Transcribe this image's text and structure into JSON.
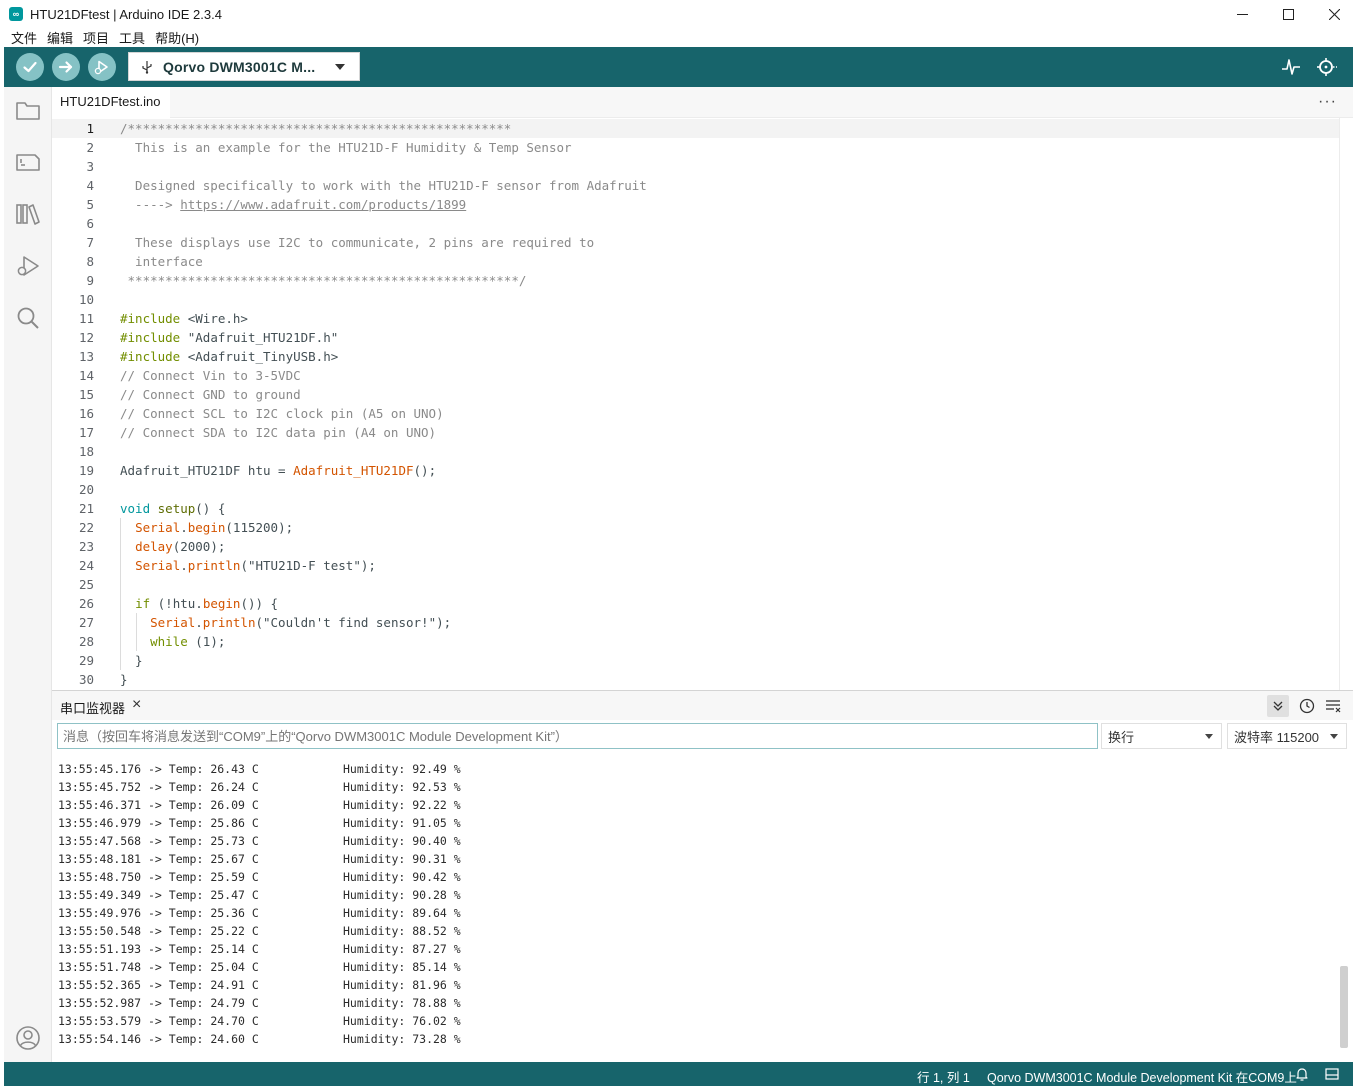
{
  "window": {
    "title": "HTU21DFtest | Arduino IDE 2.3.4",
    "icon": "arduino-logo-icon"
  },
  "menu": [
    "文件",
    "编辑",
    "项目",
    "工具",
    "帮助(H)"
  ],
  "toolbar": {
    "board": "Qorvo DWM3001C M...",
    "verify_icon": "checkmark-icon",
    "upload_icon": "arrow-right-icon",
    "debug_icon": "debug-icon",
    "plotter_icon": "serial-plotter-icon",
    "monitor_icon": "serial-monitor-icon"
  },
  "sidebar": [
    "folder-icon",
    "board-manager-icon",
    "library-icon",
    "debug-icon",
    "search-icon",
    "account-icon"
  ],
  "editor": {
    "tab": "HTU21DFtest.ino",
    "more": "···",
    "current_line": 1,
    "lines": [
      [
        {
          "t": "/***************************************************",
          "c": "#8a8a8a"
        }
      ],
      [
        {
          "t": "  This is an example for the HTU21D-F Humidity & Temp Sensor",
          "c": "#8a8a8a"
        }
      ],
      [
        {
          "t": "",
          "c": "#8a8a8a"
        }
      ],
      [
        {
          "t": "  Designed specifically to work with the HTU21D-F sensor from Adafruit",
          "c": "#8a8a8a"
        }
      ],
      [
        {
          "t": "  ----> ",
          "c": "#8a8a8a"
        },
        {
          "t": "https://www.adafruit.com/products/1899",
          "c": "#8a8a8a",
          "u": true
        }
      ],
      [
        {
          "t": "",
          "c": "#8a8a8a"
        }
      ],
      [
        {
          "t": "  These displays use I2C to communicate, 2 pins are required to",
          "c": "#8a8a8a"
        }
      ],
      [
        {
          "t": "  interface",
          "c": "#8a8a8a"
        }
      ],
      [
        {
          "t": " ****************************************************/",
          "c": "#8a8a8a"
        }
      ],
      [
        {
          "t": "",
          "c": "#434f54"
        }
      ],
      [
        {
          "t": "#include",
          "c": "#728e00"
        },
        {
          "t": " <Wire.h>",
          "c": "#434f54"
        }
      ],
      [
        {
          "t": "#include",
          "c": "#728e00"
        },
        {
          "t": " \"Adafruit_HTU21DF.h\"",
          "c": "#434f54"
        }
      ],
      [
        {
          "t": "#include",
          "c": "#728e00"
        },
        {
          "t": " <Adafruit_TinyUSB.h>",
          "c": "#434f54"
        }
      ],
      [
        {
          "t": "// Connect Vin to 3-5VDC",
          "c": "#8a8a8a"
        }
      ],
      [
        {
          "t": "// Connect GND to ground",
          "c": "#8a8a8a"
        }
      ],
      [
        {
          "t": "// Connect SCL to I2C clock pin (A5 on UNO)",
          "c": "#8a8a8a"
        }
      ],
      [
        {
          "t": "// Connect SDA to I2C data pin (A4 on UNO)",
          "c": "#8a8a8a"
        }
      ],
      [
        {
          "t": "",
          "c": "#434f54"
        }
      ],
      [
        {
          "t": "Adafruit_HTU21DF htu = ",
          "c": "#434f54"
        },
        {
          "t": "Adafruit_HTU21DF",
          "c": "#d35400"
        },
        {
          "t": "();",
          "c": "#434f54"
        }
      ],
      [
        {
          "t": "",
          "c": "#434f54"
        }
      ],
      [
        {
          "t": "void",
          "c": "#00979d"
        },
        {
          "t": " ",
          "c": "#434f54"
        },
        {
          "t": "setup",
          "c": "#5e6d03"
        },
        {
          "t": "() {",
          "c": "#434f54"
        }
      ],
      [
        {
          "t": "  ",
          "c": "#434f54"
        },
        {
          "t": "Serial",
          "c": "#d35400"
        },
        {
          "t": ".",
          "c": "#434f54"
        },
        {
          "t": "begin",
          "c": "#d35400"
        },
        {
          "t": "(115200);",
          "c": "#434f54"
        }
      ],
      [
        {
          "t": "  ",
          "c": "#434f54"
        },
        {
          "t": "delay",
          "c": "#d35400"
        },
        {
          "t": "(2000);",
          "c": "#434f54"
        }
      ],
      [
        {
          "t": "  ",
          "c": "#434f54"
        },
        {
          "t": "Serial",
          "c": "#d35400"
        },
        {
          "t": ".",
          "c": "#434f54"
        },
        {
          "t": "println",
          "c": "#d35400"
        },
        {
          "t": "(\"HTU21D-F test\");",
          "c": "#434f54"
        }
      ],
      [
        {
          "t": "",
          "c": "#434f54"
        }
      ],
      [
        {
          "t": "  ",
          "c": "#434f54"
        },
        {
          "t": "if",
          "c": "#728e00"
        },
        {
          "t": " (!htu.",
          "c": "#434f54"
        },
        {
          "t": "begin",
          "c": "#d35400"
        },
        {
          "t": "()) {",
          "c": "#434f54"
        }
      ],
      [
        {
          "t": "    ",
          "c": "#434f54"
        },
        {
          "t": "Serial",
          "c": "#d35400"
        },
        {
          "t": ".",
          "c": "#434f54"
        },
        {
          "t": "println",
          "c": "#d35400"
        },
        {
          "t": "(\"Couldn't find sensor!\");",
          "c": "#434f54"
        }
      ],
      [
        {
          "t": "    ",
          "c": "#434f54"
        },
        {
          "t": "while",
          "c": "#728e00"
        },
        {
          "t": " (1);",
          "c": "#434f54"
        }
      ],
      [
        {
          "t": "  }",
          "c": "#434f54"
        }
      ],
      [
        {
          "t": "}",
          "c": "#434f54"
        }
      ]
    ]
  },
  "serial_monitor": {
    "title": "串口监视器",
    "close": "×",
    "placeholder": "消息（按回车将消息发送到“COM9”上的“Qorvo DWM3001C Module Development Kit”）",
    "line_ending": "换行",
    "baud": "波特率 115200",
    "tools": [
      "toggle-autoscroll-icon",
      "timestamp-icon",
      "clear-output-icon"
    ],
    "output": [
      {
        "time": "13:55:45.176",
        "temp": "26.43",
        "hum": "92.49"
      },
      {
        "time": "13:55:45.752",
        "temp": "26.24",
        "hum": "92.53"
      },
      {
        "time": "13:55:46.371",
        "temp": "26.09",
        "hum": "92.22"
      },
      {
        "time": "13:55:46.979",
        "temp": "25.86",
        "hum": "91.05"
      },
      {
        "time": "13:55:47.568",
        "temp": "25.73",
        "hum": "90.40"
      },
      {
        "time": "13:55:48.181",
        "temp": "25.67",
        "hum": "90.31"
      },
      {
        "time": "13:55:48.750",
        "temp": "25.59",
        "hum": "90.42"
      },
      {
        "time": "13:55:49.349",
        "temp": "25.47",
        "hum": "90.28"
      },
      {
        "time": "13:55:49.976",
        "temp": "25.36",
        "hum": "89.64"
      },
      {
        "time": "13:55:50.548",
        "temp": "25.22",
        "hum": "88.52"
      },
      {
        "time": "13:55:51.193",
        "temp": "25.14",
        "hum": "87.27"
      },
      {
        "time": "13:55:51.748",
        "temp": "25.04",
        "hum": "85.14"
      },
      {
        "time": "13:55:52.365",
        "temp": "24.91",
        "hum": "81.96"
      },
      {
        "time": "13:55:52.987",
        "temp": "24.79",
        "hum": "78.88"
      },
      {
        "time": "13:55:53.579",
        "temp": "24.70",
        "hum": "76.02"
      },
      {
        "time": "13:55:54.146",
        "temp": "24.60",
        "hum": "73.28"
      }
    ]
  },
  "status_bar": {
    "position": "行 1, 列 1",
    "board_port": "Qorvo DWM3001C Module Development Kit 在COM9上",
    "notification_icon": "bell-icon",
    "panel_icon": "toggle-panel-icon"
  },
  "colors": {
    "toolbar_bg": "#17646b",
    "button_fill": "#85c2c5",
    "status_bg": "#17646b"
  }
}
